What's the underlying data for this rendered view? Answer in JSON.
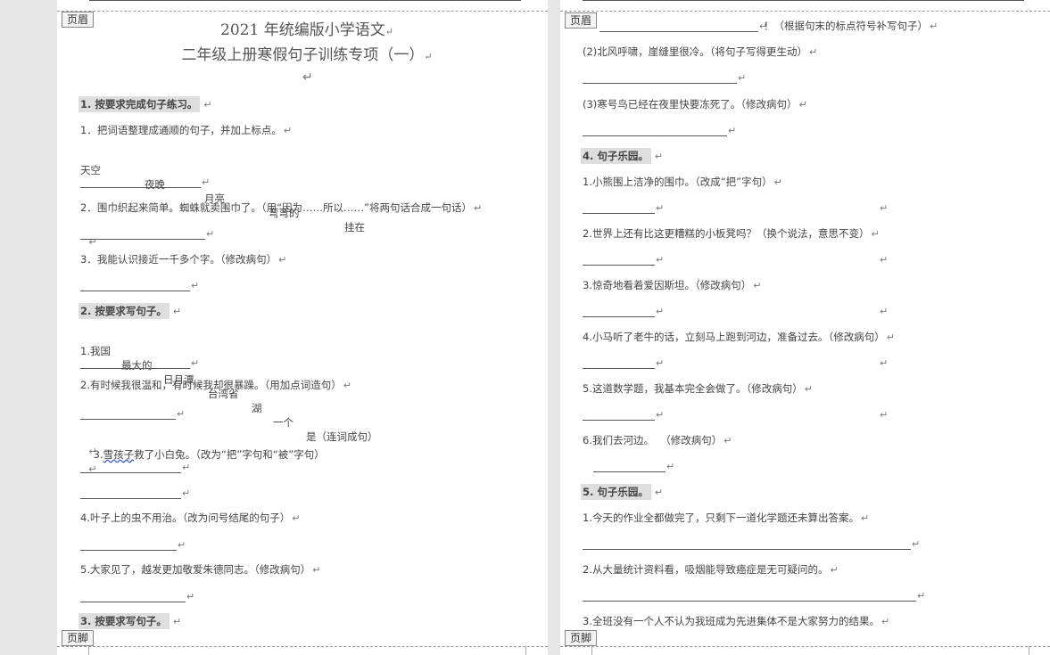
{
  "labels": {
    "header": "页眉",
    "footer": "页脚",
    "pilcrow": "↵"
  },
  "left": {
    "title1": "2021 年统编版小学语文",
    "title2": "二年级上册寒假句子训练专项（一）",
    "sec1": "1.  按要求完成句子练习。",
    "q1_1": "1．把词语整理成通顺的句子，并加上标点。",
    "words": [
      "天空",
      "夜晚",
      "月亮",
      "弯弯的",
      "挂在"
    ],
    "q1_2": "2．围巾织起来简单。蜘蛛就卖围巾了。（用“因为……所以……”将两句话合成一句话）",
    "q1_3": "3．我能认识接近一千多个字。（修改病句）",
    "sec2": "2.  按要求写句子。",
    "words2": [
      "1.我国",
      "最大的",
      "日月潭",
      "台湾省",
      "湖",
      "一个",
      "是（连词成句）"
    ],
    "q2_2": "2.有时候我很温和，有时候我却很暴躁。（用加点词造句）",
    "q2_3a": "3.",
    "q2_3b": "雪孩子",
    "q2_3c": "救了小白兔。（改为“把”字句和“被”字句）",
    "q2_4": "4.叶子上的虫不用治。（改为问号结尾的句子）",
    "q2_5": "5.大家见了，越发更加敬爱朱德同志。（修改病句）",
    "sec3": "3.  按要求写句子。"
  },
  "right": {
    "r0": "！（根据句末的标点符号补写句子）",
    "r1": "(2)北风呼啸，崖缝里很冷。（将句子写得更生动）",
    "r2": "(3)寒号鸟已经在夜里快要冻死了。（修改病句）",
    "sec4": "4.  句子乐园。",
    "s4_1": "1.小熊围上洁净的围巾。（改成“把”字句）",
    "s4_2": "2.世界上还有比这更糟糕的小板凳吗？（换个说法，意思不变）",
    "s4_3": "3.惊奇地看着爱因斯坦。（修改病句）",
    "s4_4": "4.小马听了老牛的话，立刻马上跑到河边，准备过去。（修改病句）",
    "s4_5": "5.这道数学题，我基本完全会做了。（修改病句）",
    "s4_6": "6.我们去河边。  （修改病句）",
    "sec5": "5.  句子乐园。",
    "s5_1": "1.今天的作业全都做完了，只剩下一道化学题还未算出答案。",
    "s5_2": "2.从大量统计资料看，吸烟能导致癌症是无可疑问的。",
    "s5_3": "3.全班没有一个人不认为我班成为先进集体不是大家努力的结果。"
  }
}
